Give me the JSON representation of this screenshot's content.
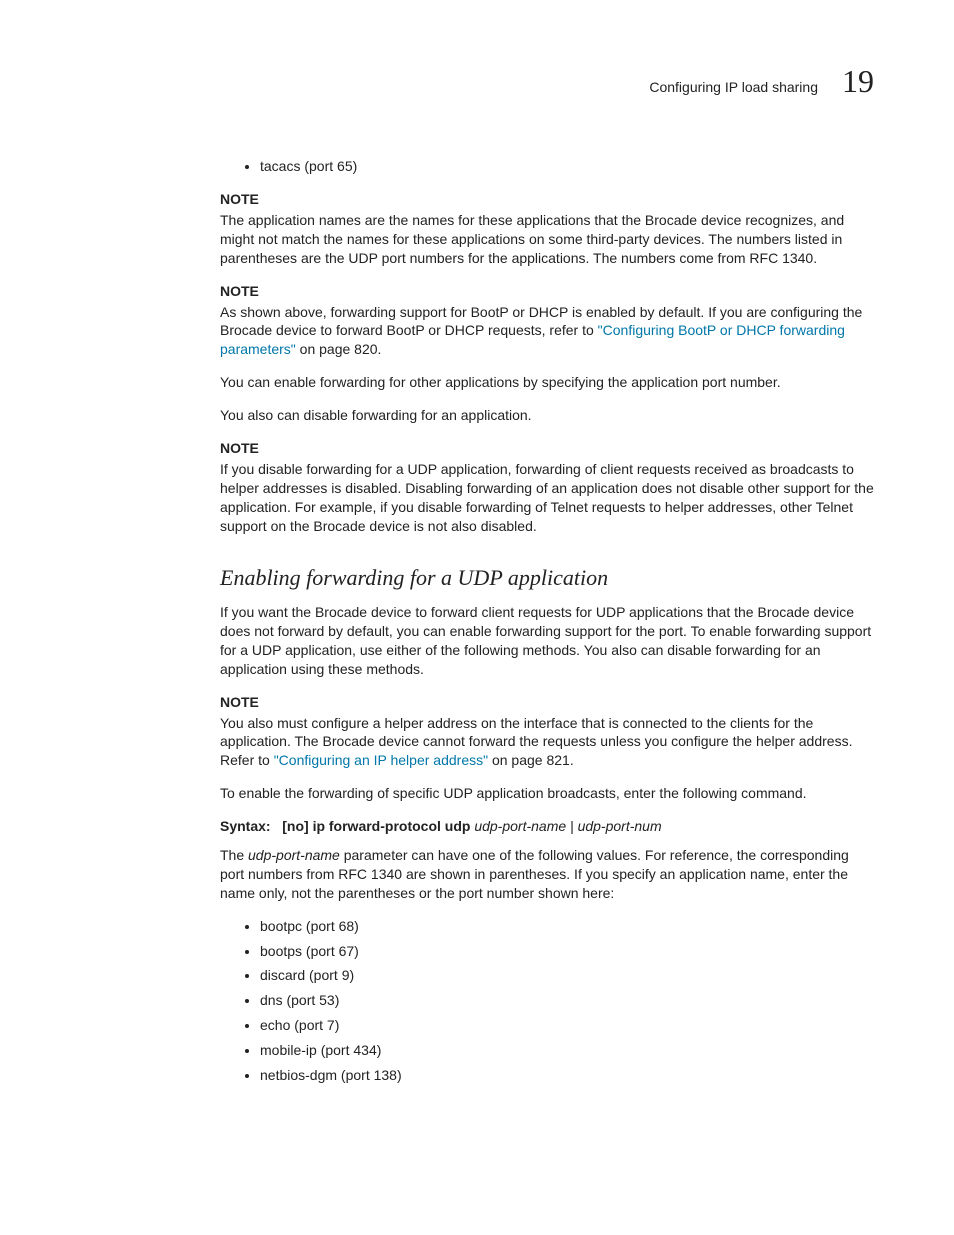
{
  "header": {
    "title": "Configuring IP load sharing",
    "chapter": "19"
  },
  "top_bullet": "tacacs (port 65)",
  "note1": {
    "label": "NOTE",
    "body": "The application names are the names for these applications that the Brocade device recognizes, and might not match the names for these applications on some third-party devices. The numbers listed in parentheses are the UDP port numbers for the applications. The numbers come from RFC 1340."
  },
  "note2": {
    "label": "NOTE",
    "body_pre": "As shown above, forwarding support for BootP or DHCP is enabled by default. If you are configuring the Brocade device to forward BootP or DHCP requests, refer to ",
    "link": "\"Configuring BootP or DHCP forwarding parameters\"",
    "body_post": " on page 820."
  },
  "para1": "You can enable forwarding for other applications by specifying the application port number.",
  "para2": "You also can disable forwarding for an application.",
  "note3": {
    "label": "NOTE",
    "body": "If you disable forwarding for a UDP application, forwarding of client requests received as broadcasts to helper addresses is disabled. Disabling forwarding of an application does not disable other support for the application. For example, if you disable forwarding of Telnet requests to helper addresses, other Telnet support on the Brocade device is not also disabled."
  },
  "heading": "Enabling forwarding for a UDP application",
  "intro": "If you want the Brocade device to forward client requests for UDP applications that the Brocade device does not forward by default, you can enable forwarding support for the port. To enable forwarding support for a UDP application, use either of the following methods. You also can disable forwarding for an application using these methods.",
  "note4": {
    "label": "NOTE",
    "body_pre": "You also must configure a helper address on the interface that is connected to the clients for the application. The Brocade device cannot forward the requests unless you configure the helper address. Refer to ",
    "link": "\"Configuring an IP helper address\"",
    "body_post": " on page 821."
  },
  "para3": "To enable the forwarding of specific UDP application broadcasts, enter the following command.",
  "syntax": {
    "label": "Syntax:",
    "cmd": "[no] ip forward-protocol udp",
    "args": "udp-port-name | udp-port-num"
  },
  "param_para_pre": "The ",
  "param_name": "udp-port-name",
  "param_para_post": " parameter can have one of the following values. For reference, the corresponding port numbers from RFC 1340 are shown in parentheses. If you specify an application name, enter the name only, not the parentheses or the port number shown here:",
  "ports": [
    "bootpc (port 68)",
    "bootps (port 67)",
    "discard (port 9)",
    "dns (port 53)",
    "echo (port 7)",
    "mobile-ip (port 434)",
    "netbios-dgm (port 138)"
  ]
}
